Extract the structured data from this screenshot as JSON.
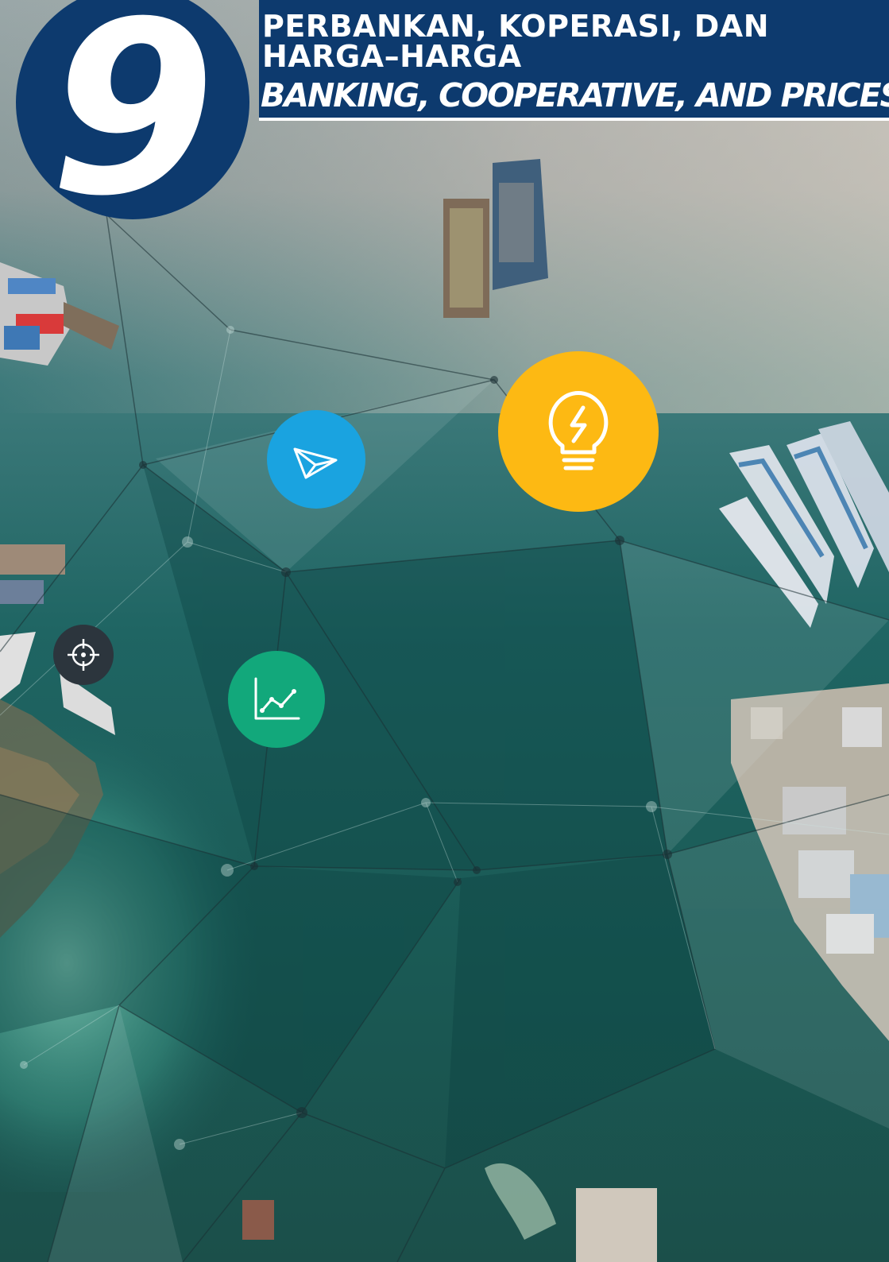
{
  "chapter": {
    "number": "9",
    "title_id_line1": "PERBANKAN, KOPERASI, DAN",
    "title_id_line2": "HARGA–HARGA",
    "title_en": "BANKING, COOPERATIVE, AND PRICES"
  },
  "icons": [
    {
      "name": "paper-plane-icon",
      "color": "#1aa3e0"
    },
    {
      "name": "lightbulb-icon",
      "color": "#fdb913"
    },
    {
      "name": "line-chart-icon",
      "color": "#12a87b"
    },
    {
      "name": "crosshair-icon",
      "color": "#2c353d"
    }
  ],
  "colors": {
    "header_navy": "#0d3a6e",
    "water": "#2a6f74"
  }
}
